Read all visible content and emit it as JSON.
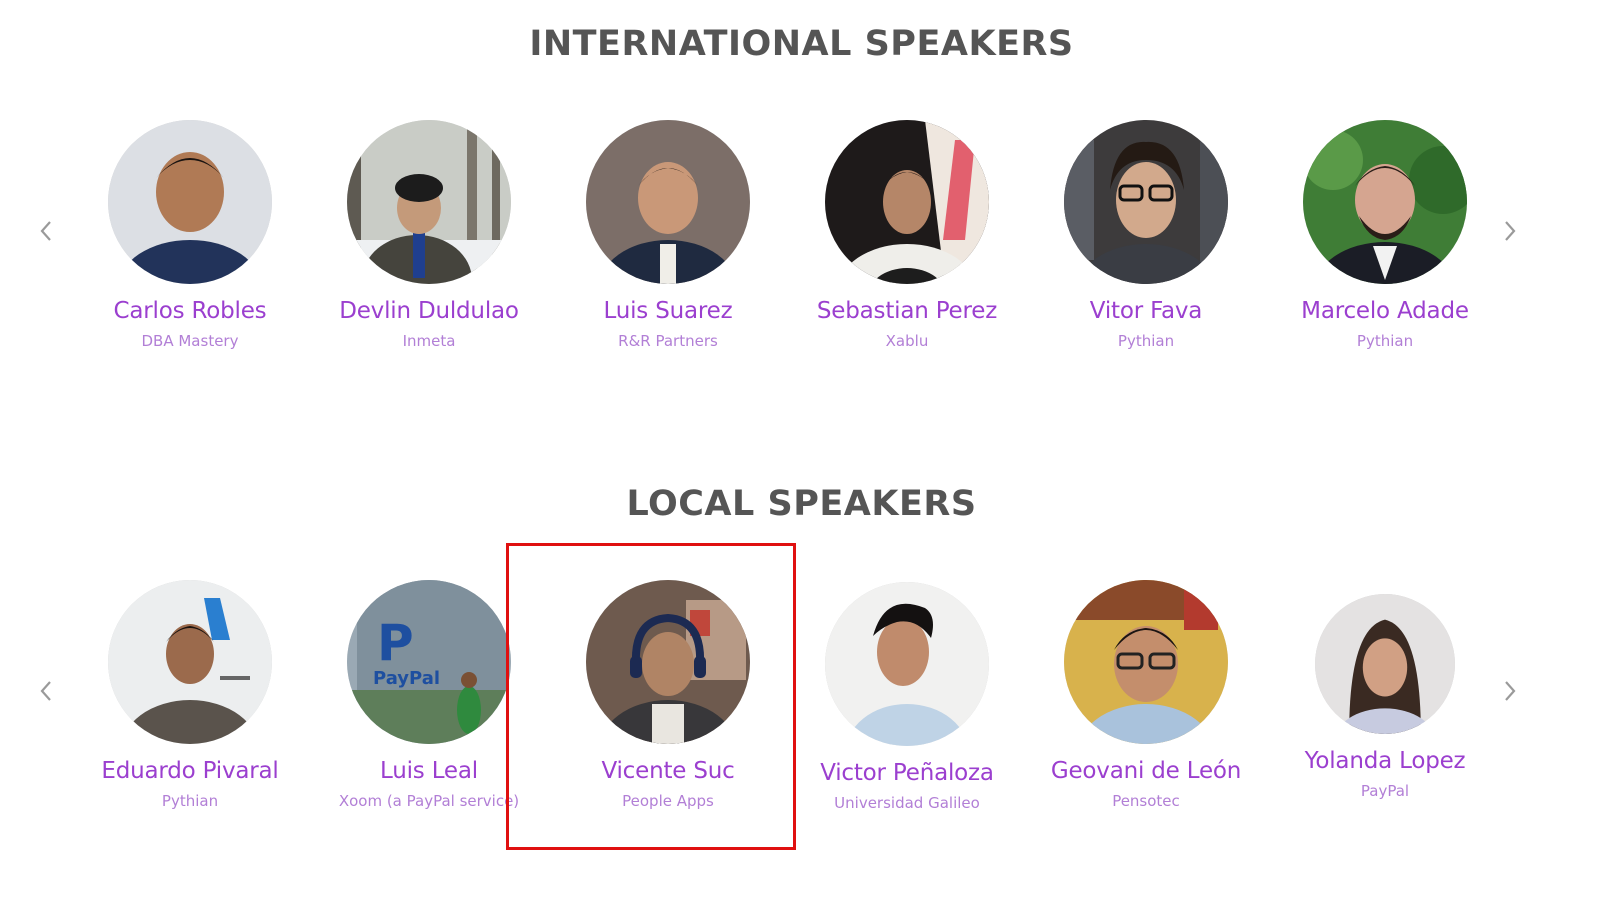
{
  "international": {
    "title": "INTERNATIONAL SPEAKERS",
    "speakers": [
      {
        "name": "Carlos Robles",
        "company": "DBA Mastery"
      },
      {
        "name": "Devlin Duldulao",
        "company": "Inmeta"
      },
      {
        "name": "Luis Suarez",
        "company": "R&R Partners"
      },
      {
        "name": "Sebastian Perez",
        "company": "Xablu"
      },
      {
        "name": "Vitor Fava",
        "company": "Pythian"
      },
      {
        "name": "Marcelo Adade",
        "company": "Pythian"
      }
    ]
  },
  "local": {
    "title": "LOCAL SPEAKERS",
    "speakers": [
      {
        "name": "Eduardo Pivaral",
        "company": "Pythian"
      },
      {
        "name": "Luis Leal",
        "company": "Xoom (a PayPal service)"
      },
      {
        "name": "Vicente Suc",
        "company": "People Apps"
      },
      {
        "name": "Victor Peñaloza",
        "company": "Universidad Galileo"
      },
      {
        "name": "Geovani de León",
        "company": "Pensotec"
      },
      {
        "name": "Yolanda Lopez",
        "company": "PayPal"
      }
    ]
  },
  "colors": {
    "name": "#9b3fcf",
    "company": "#b27fd6",
    "heading": "#555555",
    "arrow": "#9a9a9a",
    "highlight": "#e01010"
  },
  "icons": {
    "prev": "chevron-left-icon",
    "next": "chevron-right-icon"
  }
}
